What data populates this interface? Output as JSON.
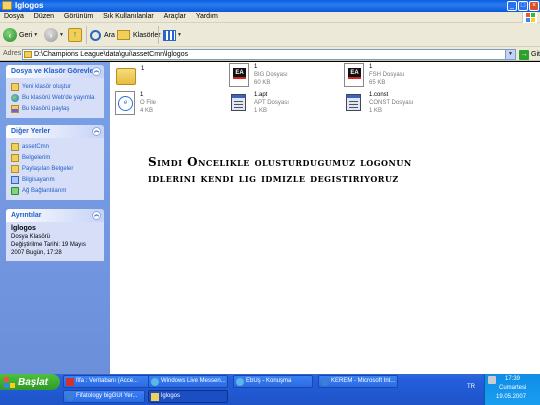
{
  "window": {
    "title": "Iglogos"
  },
  "menu": [
    "Dosya",
    "Düzen",
    "Görünüm",
    "Sık Kullanılanlar",
    "Araçlar",
    "Yardım"
  ],
  "toolbar": {
    "back_label": "Geri",
    "search_label": "Ara",
    "folders_label": "Klasörler"
  },
  "address": {
    "label": "Adres",
    "path": "D:\\Champions League\\data\\gui\\assetCmn\\lglogos",
    "go_label": "Git"
  },
  "sidebar": {
    "tasks": {
      "title": "Dosya ve Klasör Görevleri",
      "items": [
        "Yeni klasör oluştur",
        "Bu klasörü Web'de yayımla",
        "Bu klasörü paylaş"
      ]
    },
    "places": {
      "title": "Diğer Yerler",
      "items": [
        "assetCmn",
        "Belgelerim",
        "Paylaşılan Belgeler",
        "Bilgisayarım",
        "Ağ Bağlantılarım"
      ]
    },
    "details": {
      "title": "Ayrıntılar",
      "name": "lglogos",
      "type": "Dosya Klasörü",
      "modified": "Değiştirilme Tarihi: 19 Mayıs 2007 Bugün, 17:28"
    }
  },
  "files": [
    {
      "name": "1",
      "type": "",
      "size": "",
      "icon": "folder-icon"
    },
    {
      "name": "1",
      "type": "BIG Dosyası",
      "size": "60 KB",
      "icon": "ea-file-icon"
    },
    {
      "name": "1",
      "type": "FSH Dosyası",
      "size": "65 KB",
      "icon": "ea-file-icon"
    },
    {
      "name": "1",
      "type": "O File",
      "size": "4 KB",
      "icon": "o-file-icon"
    },
    {
      "name": "1.apt",
      "type": "APT Dosyası",
      "size": "1 KB",
      "icon": "generic-file-icon"
    },
    {
      "name": "1.const",
      "type": "CONST Dosyası",
      "size": "1 KB",
      "icon": "generic-file-icon"
    }
  ],
  "overlay_text": {
    "line1": "Simdi Oncelikle olusturdugumuz logonun",
    "line2": "idlerini kendi lig idmizle degistiriyoruz"
  },
  "taskbar": {
    "start_label": "Başlat",
    "buttons": [
      "fifa : Veritabanı (Acce...",
      "Windows Live Messen...",
      "EbUş - Konuşma",
      "KEREM - Microsoft Int...",
      "Fifatology bigGUI Yer...",
      "lglogos"
    ],
    "lang": "TR",
    "clock": {
      "time": "17:39",
      "day": "Cumartesi",
      "date": "19.05.2007"
    }
  },
  "colors": {
    "title_bar": "#0a5fe0",
    "sidebar_bg": "#7aa1e6",
    "taskbar": "#245edc",
    "start_button": "#3c9a2f"
  }
}
